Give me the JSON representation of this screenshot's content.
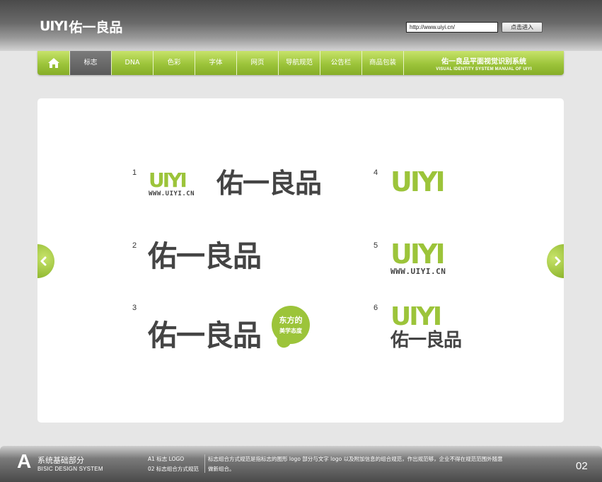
{
  "header": {
    "brand_mark": "UIYI",
    "brand_name": "佑一良品",
    "url_value": "http://www.uiyi.cn/",
    "enter_button": "点击进入"
  },
  "nav": {
    "items": [
      {
        "label": "标志",
        "active": true
      },
      {
        "label": "DNA"
      },
      {
        "label": "色彩"
      },
      {
        "label": "字体"
      },
      {
        "label": "网页"
      },
      {
        "label": "导航规范"
      },
      {
        "label": "公告栏"
      },
      {
        "label": "商品包装"
      }
    ],
    "title_cn": "佑一良品平面视觉识别系统",
    "title_en": "VISUAL IDENTITY SYSTEM MANUAL OF UIYI"
  },
  "logos": {
    "n1": "1",
    "n2": "2",
    "n3": "3",
    "n4": "4",
    "n5": "5",
    "n6": "6",
    "mark": "UIYI",
    "url": "WWW.UIYI.CN",
    "name": "佑一良品",
    "slogan_line1": "东方的",
    "slogan_line2": "美学态度"
  },
  "footer": {
    "letter": "A",
    "section_cn": "系统基础部分",
    "section_en": "BISIC DESIGN SYSTEM",
    "line1": "A1 标志 LOGO",
    "line2": "02 标志组合方式规范",
    "description": "标志组合方式规范是指标志的图形 logo 部分与文字 logo 以及附加信息的组合规范，作出规范够，企业不得在规范范围外随意做新组合。",
    "page": "02"
  },
  "colors": {
    "accent_green": "#9cc43a",
    "text_dark": "#444444",
    "active_tab": "#5a5a5a"
  }
}
